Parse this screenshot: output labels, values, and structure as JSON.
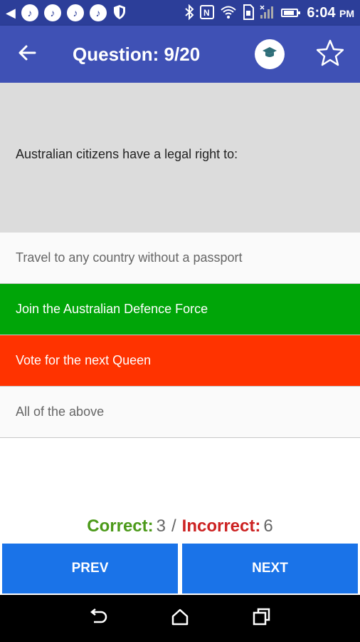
{
  "status_bar": {
    "time": "6:04",
    "ampm": "PM",
    "notification_icons": [
      "back-arrow-icon",
      "music-icon",
      "music-icon",
      "music-icon",
      "music-icon",
      "shield-icon"
    ],
    "system_icons": [
      "bluetooth-icon",
      "nfc-icon",
      "wifi-icon",
      "sim-icon",
      "signal-icon",
      "battery-icon"
    ]
  },
  "app_bar": {
    "title": "Question: 9/20",
    "back_icon": "arrow-left-icon",
    "cap_icon": "graduation-cap-icon",
    "star_icon": "star-outline-icon",
    "color": "#3f51b5"
  },
  "question": {
    "text": "Australian citizens have a legal right to:"
  },
  "options": [
    {
      "label": "Travel to any country without a passport",
      "state": "plain"
    },
    {
      "label": "Join the Australian Defence Force",
      "state": "correct"
    },
    {
      "label": "Vote for the next Queen",
      "state": "wrong"
    },
    {
      "label": "All of the above",
      "state": "plain"
    }
  ],
  "score": {
    "correct_label": "Correct:",
    "correct_value": "3",
    "separator": "/",
    "incorrect_label": "Incorrect:",
    "incorrect_value": "6"
  },
  "buttons": {
    "prev": "PREV",
    "next": "NEXT"
  },
  "colors": {
    "correct": "#00a508",
    "wrong": "#ff3300",
    "button": "#1a73e8"
  }
}
